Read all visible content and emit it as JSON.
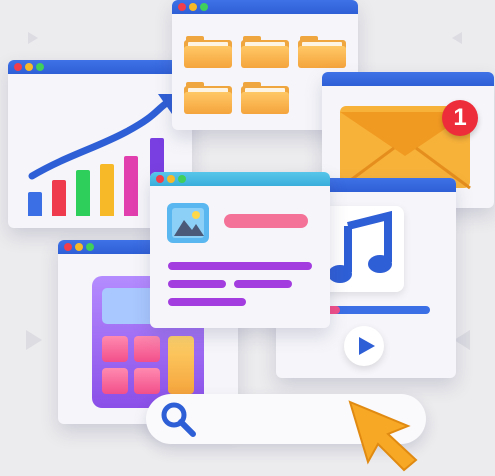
{
  "mail": {
    "badge": "1"
  },
  "colors": {
    "background": "#ececee",
    "titlebar_blue": "#2f5fd6",
    "titlebar_cyan": "#3aaedc",
    "folder": "#f5a43c",
    "badge": "#ee2d3a",
    "accent_purple": "#a33de0",
    "accent_pink": "#f24f8a",
    "cursor": "#f7a824"
  },
  "icons": [
    "folder-icon",
    "envelope-icon",
    "music-note-icon",
    "play-icon",
    "image-icon",
    "search-icon",
    "cursor-icon",
    "chart-icon",
    "calculator-icon"
  ]
}
